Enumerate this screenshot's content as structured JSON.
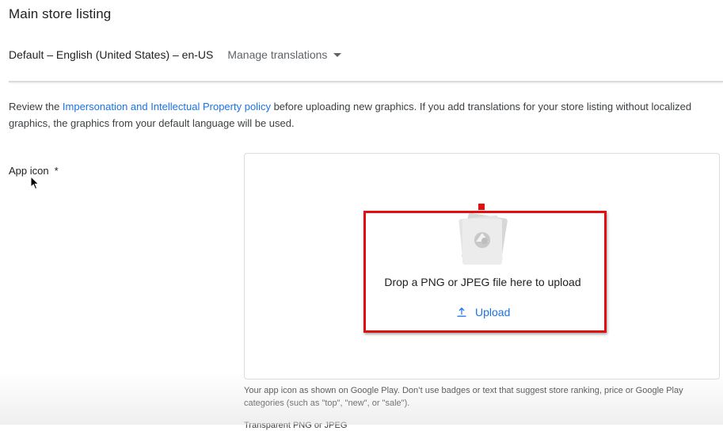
{
  "header": {
    "title": "Main store listing",
    "default_language": "Default – English (United States) – en-US",
    "manage_translations": "Manage translations"
  },
  "notice": {
    "prefix": "Review the ",
    "link": "Impersonation and Intellectual Property policy",
    "suffix": " before uploading new graphics. If you add translations for your store listing without localized graphics, the graphics from your default language will be used."
  },
  "app_icon": {
    "label": "App icon",
    "required_marker": "*",
    "drop_text": "Drop a PNG or JPEG file here to upload",
    "upload_label": "Upload",
    "helper_text": "Your app icon as shown on Google Play. Don’t use badges or text that suggest store ranking, price or Google Play categories (such as \"top\", \"new\", or \"sale\").",
    "format_text": "Transparent PNG or JPEG"
  },
  "colors": {
    "accent": "#1a73e8",
    "highlight": "#e01010",
    "text_primary": "#202124",
    "text_secondary": "#5f6368"
  },
  "icons": [
    "caret-down-icon",
    "mouse-cursor-icon",
    "image-placeholder-icon",
    "upload-icon"
  ]
}
